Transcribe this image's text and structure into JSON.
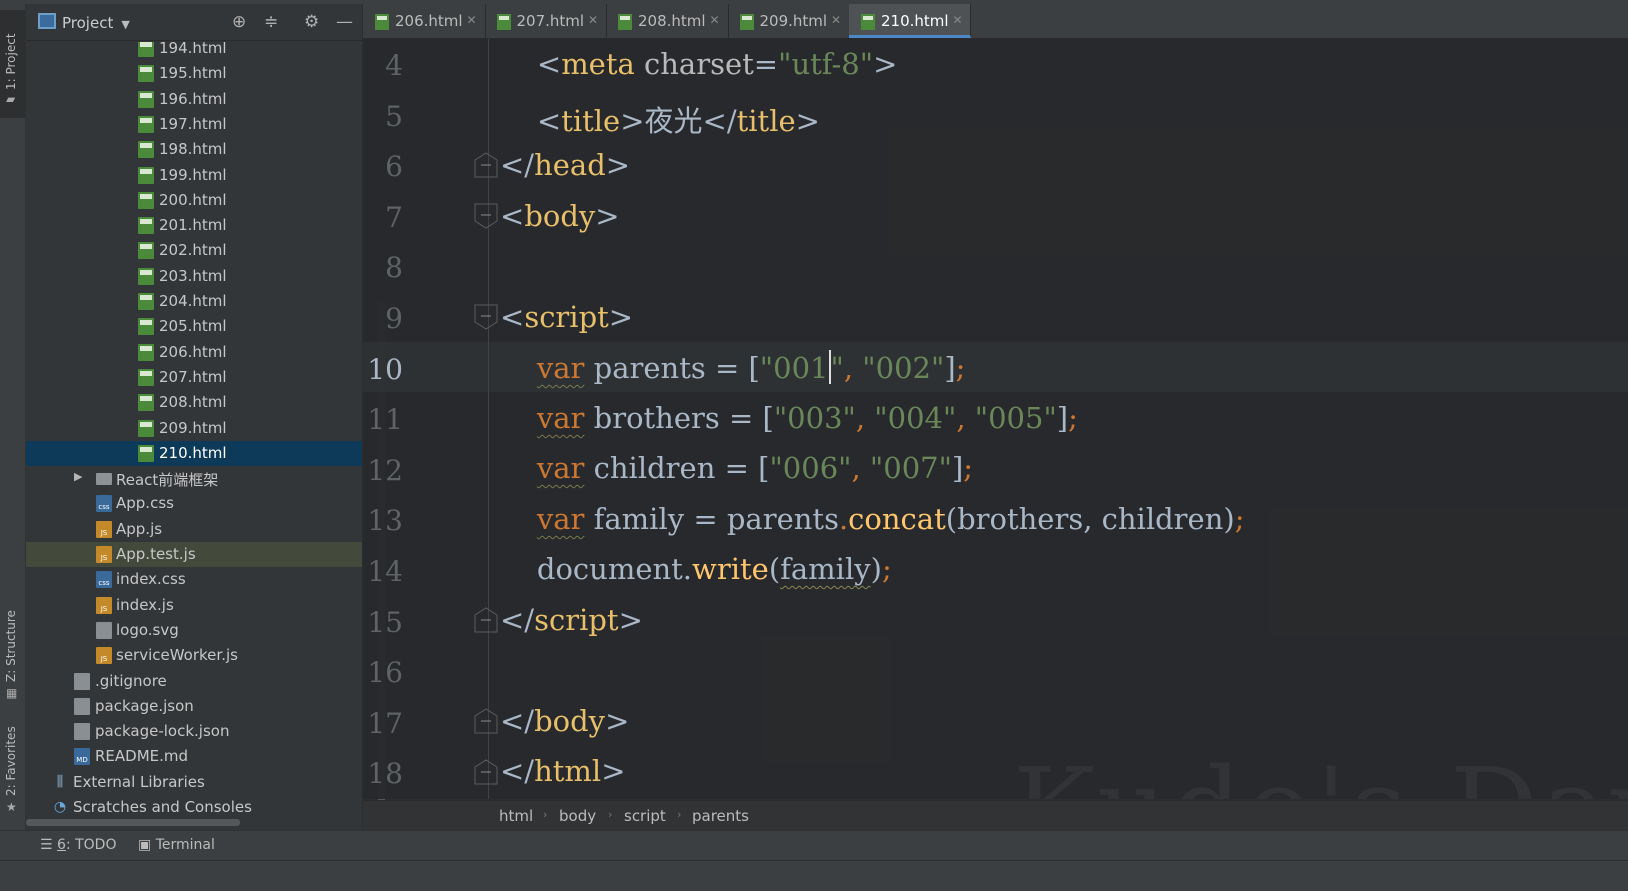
{
  "toolwindows": {
    "project": "1: Project",
    "structure": "Z: Structure",
    "favorites": "2: Favorites"
  },
  "project_panel": {
    "title": "Project",
    "icons": [
      "locate-icon",
      "collapse-icon",
      "gear-icon",
      "minimize-icon"
    ]
  },
  "tree": {
    "html_files": [
      "194.html",
      "195.html",
      "196.html",
      "197.html",
      "198.html",
      "199.html",
      "200.html",
      "201.html",
      "202.html",
      "203.html",
      "204.html",
      "205.html",
      "206.html",
      "207.html",
      "208.html",
      "209.html",
      "210.html"
    ],
    "selected": "210.html",
    "folder": "React前端框架",
    "src_files": [
      {
        "name": "App.css",
        "type": "css"
      },
      {
        "name": "App.js",
        "type": "js"
      },
      {
        "name": "App.test.js",
        "type": "js"
      },
      {
        "name": "index.css",
        "type": "css"
      },
      {
        "name": "index.js",
        "type": "js"
      },
      {
        "name": "logo.svg",
        "type": "file"
      },
      {
        "name": "serviceWorker.js",
        "type": "js"
      }
    ],
    "root_files": [
      {
        "name": ".gitignore",
        "type": "file"
      },
      {
        "name": "package.json",
        "type": "file"
      },
      {
        "name": "package-lock.json",
        "type": "file"
      },
      {
        "name": "README.md",
        "type": "md"
      }
    ],
    "external_libraries": "External Libraries",
    "scratches": "Scratches and Consoles"
  },
  "tabs": [
    {
      "label": "206.html",
      "active": false
    },
    {
      "label": "207.html",
      "active": false
    },
    {
      "label": "208.html",
      "active": false
    },
    {
      "label": "209.html",
      "active": false
    },
    {
      "label": "210.html",
      "active": true
    }
  ],
  "editor": {
    "current_line": 10,
    "line_numbers": [
      "4",
      "5",
      "6",
      "7",
      "8",
      "9",
      "10",
      "11",
      "12",
      "13",
      "14",
      "15",
      "16",
      "17",
      "18"
    ],
    "code": {
      "meta_attr": "charset",
      "meta_value": "\"utf-8\"",
      "title_text": "夜光",
      "parents_name": "parents",
      "parents_values": [
        "\"001",
        "\"",
        "\"002\""
      ],
      "brothers_name": "brothers",
      "brothers_values": [
        "\"003\"",
        "\"004\"",
        "\"005\""
      ],
      "children_name": "children",
      "children_values": [
        "\"006\"",
        "\"007\""
      ],
      "family_name": "family",
      "concat_fn": "concat",
      "concat_args": "brothers, children",
      "write_obj": "document.",
      "write_fn": "write",
      "write_arg": "family"
    },
    "watermark": "Kudo's Day"
  },
  "breadcrumb": [
    "html",
    "body",
    "script",
    "parents"
  ],
  "bottom_tools": {
    "todo_key": "6",
    "todo_label": ": TODO",
    "terminal": "Terminal"
  },
  "colors": {
    "tag": "#e8bf6a",
    "keyword": "#cc7832",
    "string": "#6a8759",
    "function": "#ffc66d",
    "selection": "#0d3a58",
    "active_tab_underline": "#4a88c7"
  }
}
